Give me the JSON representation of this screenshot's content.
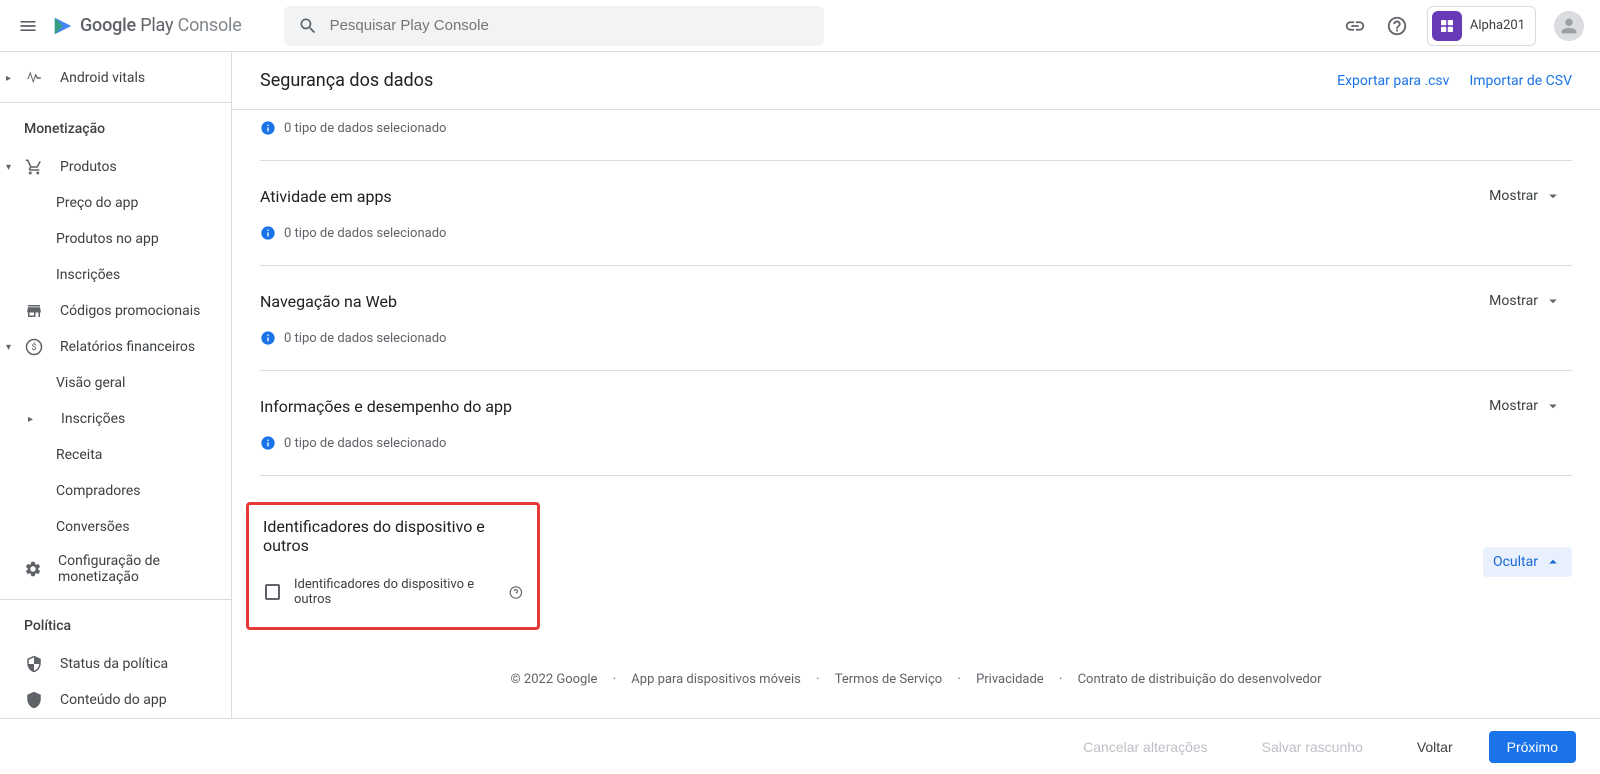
{
  "header": {
    "logo_google": "Google",
    "logo_play": "Play",
    "logo_console": "Console",
    "search_placeholder": "Pesquisar Play Console",
    "account_name": "Alpha201"
  },
  "sidebar": {
    "item_android_vitals": "Android vitals",
    "section_monetizacao": "Monetização",
    "item_produtos": "Produtos",
    "item_preco": "Preço do app",
    "item_produtos_app": "Produtos no app",
    "item_inscricoes": "Inscrições",
    "item_codigos": "Códigos promocionais",
    "item_relatorios": "Relatórios financeiros",
    "item_visao": "Visão geral",
    "item_inscricoes2": "Inscrições",
    "item_receita": "Receita",
    "item_compradores": "Compradores",
    "item_conversoes": "Conversões",
    "item_config": "Configuração de monetização",
    "section_politica": "Política",
    "item_status": "Status da política",
    "item_conteudo": "Conteúdo do app"
  },
  "page": {
    "title": "Segurança dos dados",
    "export_csv": "Exportar para .csv",
    "import_csv": "Importar de CSV",
    "info_text": "0 tipo de dados selecionado",
    "show_label": "Mostrar",
    "hide_label": "Ocultar"
  },
  "sections": {
    "atividade": "Atividade em apps",
    "navegacao": "Navegação na Web",
    "info_desempenho": "Informações e desempenho do app",
    "identificadores": "Identificadores do dispositivo e outros",
    "identificadores_check": "Identificadores do dispositivo e outros"
  },
  "footer": {
    "copyright": "© 2022 Google",
    "app_mobile": "App para dispositivos móveis",
    "termos": "Termos de Serviço",
    "privacidade": "Privacidade",
    "contrato": "Contrato de distribuição do desenvolvedor"
  },
  "bottom": {
    "cancel": "Cancelar alterações",
    "save_draft": "Salvar rascunho",
    "back": "Voltar",
    "next": "Próximo"
  }
}
